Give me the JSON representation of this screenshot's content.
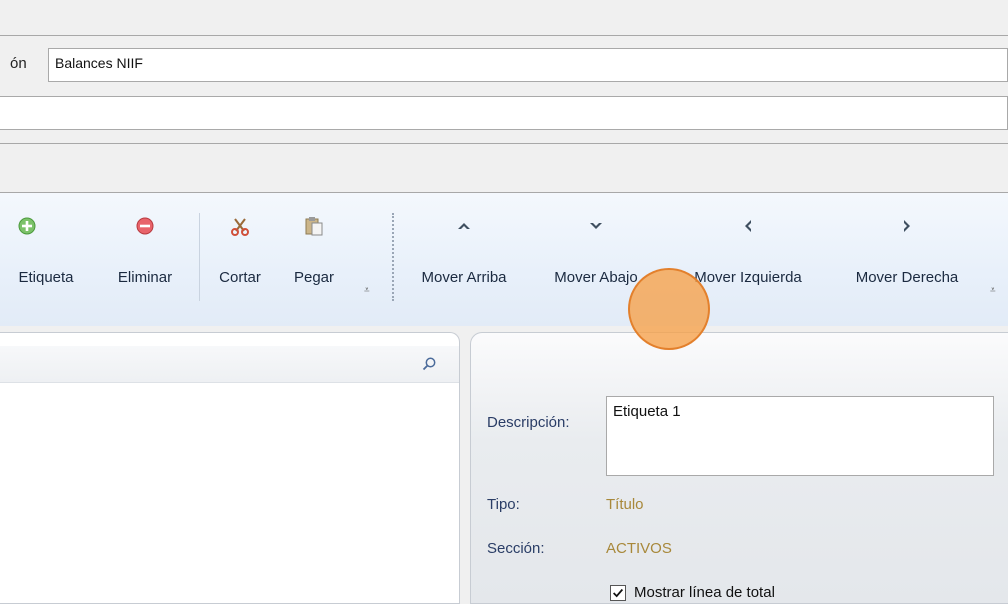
{
  "header": {
    "name_label_fragment": "ón",
    "name_value": "Balances NIIF",
    "second_value": ""
  },
  "toolbar": {
    "etiqueta": "Etiqueta",
    "eliminar": "Eliminar",
    "cortar": "Cortar",
    "pegar": "Pegar",
    "mover_arriba": "Mover Arriba",
    "mover_abajo": "Mover Abajo",
    "mover_izquierda": "Mover Izquierda",
    "mover_derecha": "Mover Derecha",
    "more_glyph": "⩡"
  },
  "left_panel": {
    "search_icon": "search-icon"
  },
  "properties": {
    "descripcion_label": "Descripción:",
    "descripcion_value": "Etiqueta 1",
    "tipo_label": "Tipo:",
    "tipo_value": "Título",
    "seccion_label": "Sección:",
    "seccion_value": "ACTIVOS",
    "mostrar_total_label": "Mostrar línea de total",
    "mostrar_total_checked": true
  },
  "colors": {
    "accent_value": "#a8883a",
    "label_blue": "#2a3d66",
    "cursor_highlight": "#f6a048"
  }
}
